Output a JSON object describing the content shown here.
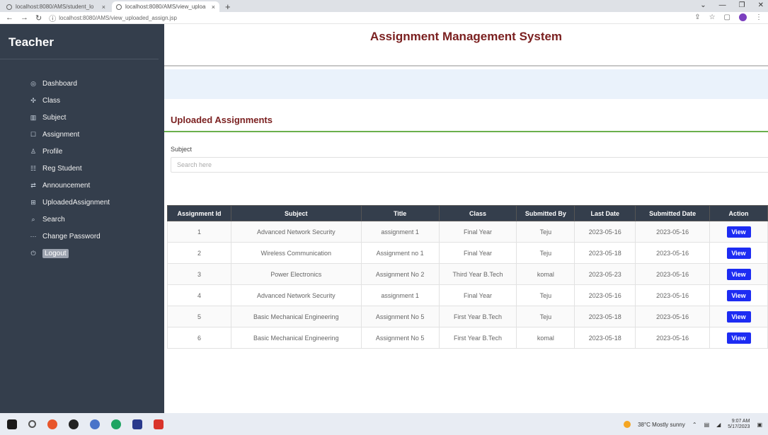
{
  "browser": {
    "tabs": [
      {
        "title": "localhost:8080/AMS/student_lo",
        "close": "×",
        "active": false
      },
      {
        "title": "localhost:8080/AMS/view_uploa",
        "close": "×",
        "active": true
      }
    ],
    "new_tab": "+",
    "url": "localhost:8080/AMS/view_uploaded_assign.jsp"
  },
  "sidebar": {
    "brand": "Teacher",
    "items": [
      {
        "label": "Dashboard",
        "icon": "dashboard-icon",
        "glyph": "◎"
      },
      {
        "label": "Class",
        "icon": "class-icon",
        "glyph": "✣"
      },
      {
        "label": "Subject",
        "icon": "subject-icon",
        "glyph": "▥"
      },
      {
        "label": "Assignment",
        "icon": "assignment-icon",
        "glyph": "☐"
      },
      {
        "label": "Profile",
        "icon": "profile-icon",
        "glyph": "♙"
      },
      {
        "label": "Reg Student",
        "icon": "reg-student-icon",
        "glyph": "☷"
      },
      {
        "label": "Announcement",
        "icon": "announcement-icon",
        "glyph": "⇄"
      },
      {
        "label": "UploadedAssignment",
        "icon": "uploaded-icon",
        "glyph": "⊞"
      },
      {
        "label": "Search",
        "icon": "search-icon",
        "glyph": "⌕"
      },
      {
        "label": "Change Password",
        "icon": "password-icon",
        "glyph": "⋯"
      },
      {
        "label": "Logout",
        "icon": "logout-icon",
        "glyph": "⏻"
      }
    ]
  },
  "header": {
    "title": "Assignment Management System"
  },
  "page": {
    "section_title": "Uploaded Assignments",
    "subject_label": "Subject",
    "search_placeholder": "Search here"
  },
  "table": {
    "columns": [
      "Assignment Id",
      "Subject",
      "Title",
      "Class",
      "Submitted By",
      "Last Date",
      "Submitted Date",
      "Action"
    ],
    "rows": [
      [
        "1",
        "Advanced Network Security",
        "assignment 1",
        "Final Year",
        "Teju",
        "2023-05-16",
        "2023-05-16"
      ],
      [
        "2",
        "Wireless Communication",
        "Assignment no 1",
        "Final Year",
        "Teju",
        "2023-05-18",
        "2023-05-16"
      ],
      [
        "3",
        "Power Electronics",
        "Assignment No 2",
        "Third Year B.Tech",
        "komal",
        "2023-05-23",
        "2023-05-16"
      ],
      [
        "4",
        "Advanced Network Security",
        "assignment 1",
        "Final Year",
        "Teju",
        "2023-05-16",
        "2023-05-16"
      ],
      [
        "5",
        "Basic Mechanical Engineering",
        "Assignment No 5",
        "First Year B.Tech",
        "Teju",
        "2023-05-18",
        "2023-05-16"
      ],
      [
        "6",
        "Basic Mechanical Engineering",
        "Assignment No 5",
        "First Year B.Tech",
        "komal",
        "2023-05-18",
        "2023-05-16"
      ]
    ],
    "action_label": "View"
  },
  "taskbar": {
    "weather": "38°C Mostly sunny",
    "time": "9:07 AM",
    "date": "5/17/2023"
  },
  "colors": {
    "sidebar_bg": "#343e4c",
    "title_red": "#7a1f1f",
    "view_button": "#1d2cf3",
    "divider_green": "#6ab04c"
  }
}
